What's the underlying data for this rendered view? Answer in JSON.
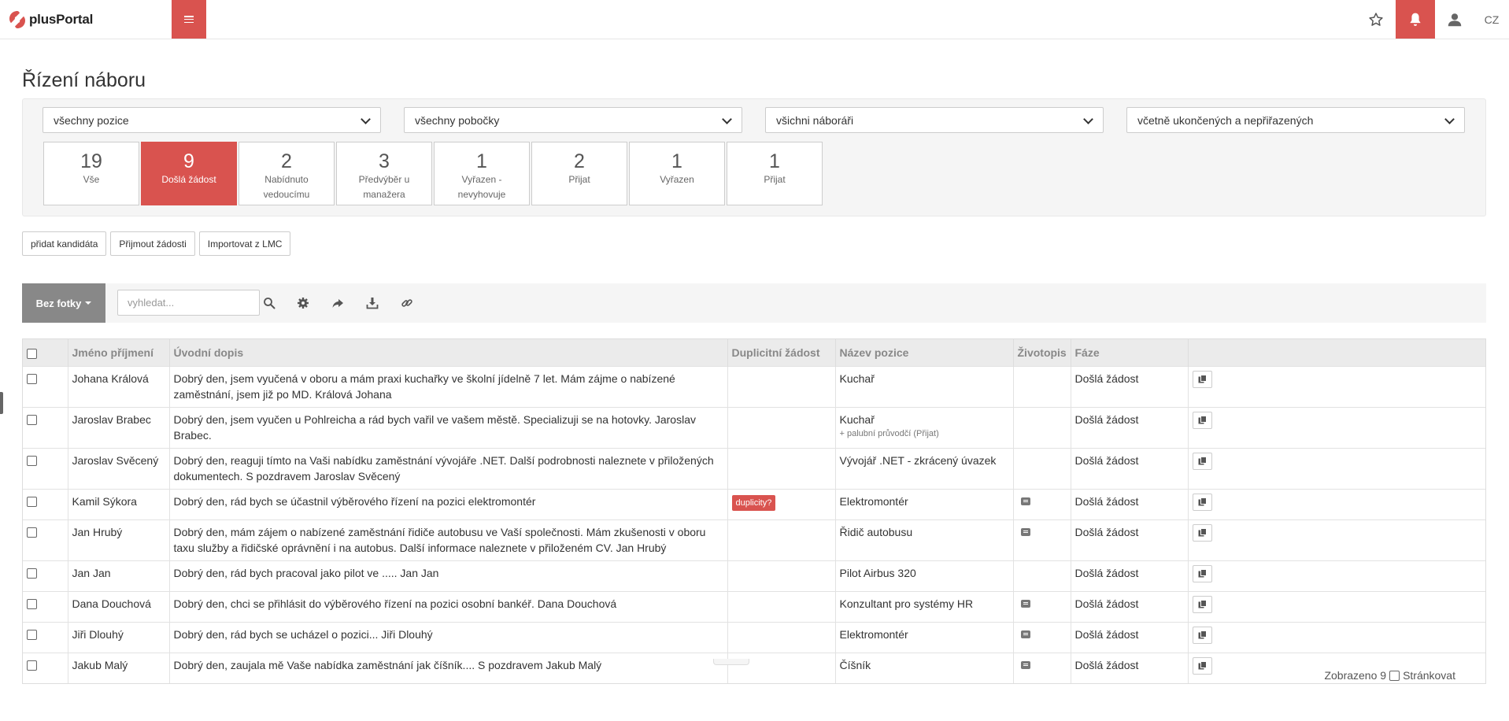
{
  "header": {
    "logo_text": "plusPortal",
    "lang": "CZ",
    "accent": "#d9534f"
  },
  "page": {
    "title": "Řízení náboru"
  },
  "filters": [
    "všechny pozice",
    "všechny pobočky",
    "všichni náboráři",
    "včetně ukončených a nepřiřazených"
  ],
  "stages": [
    {
      "count": "19",
      "label": "Vše"
    },
    {
      "count": "9",
      "label": "Došlá žádost"
    },
    {
      "count": "2",
      "label": "Nabídnuto vedoucímu"
    },
    {
      "count": "3",
      "label": "Předvýběr u manažera"
    },
    {
      "count": "1",
      "label": "Vyřazen - nevyhovuje"
    },
    {
      "count": "2",
      "label": "Přijat"
    },
    {
      "count": "1",
      "label": "Vyřazen"
    },
    {
      "count": "1",
      "label": "Přijat"
    }
  ],
  "actions": {
    "add_candidate": "přidat kandidáta",
    "accept_requests": "Přijmout žádosti",
    "import_lmc": "Importovat z LMC"
  },
  "toolbar": {
    "photo_toggle": "Bez fotky",
    "search_placeholder": "vyhledat..."
  },
  "table": {
    "columns": {
      "name": "Jméno příjmení",
      "letter": "Úvodní dopis",
      "duplicate": "Duplicitní žádost",
      "position": "Název pozice",
      "cv": "Životopis",
      "phase": "Fáze"
    },
    "rows": [
      {
        "name": "Johana Králová",
        "letter": "Dobrý den, jsem vyučená v oboru a mám praxi kuchařky ve školní jídelně 7 let. Mám zájme o nabízené zaměstnání, jsem již po MD. Králová Johana",
        "duplicate": "",
        "position": "Kuchař",
        "position_sub": "",
        "cv": false,
        "phase": "Došlá žádost"
      },
      {
        "name": "Jaroslav Brabec",
        "letter": "Dobrý den, jsem vyučen u Pohlreicha a rád bych vařil ve vašem městě. Specializuji se na hotovky. Jaroslav Brabec.",
        "duplicate": "",
        "position": "Kuchař",
        "position_sub": "+ palubní průvodčí (Přijat)",
        "cv": false,
        "phase": "Došlá žádost"
      },
      {
        "name": "Jaroslav Svěcený",
        "letter": "Dobrý den, reaguji tímto na Vaši nabídku zaměstnání vývojáře .NET. Další podrobnosti naleznete v přiložených dokumentech. S pozdravem Jaroslav Svěcený",
        "duplicate": "",
        "position": "Vývojář .NET - zkrácený úvazek",
        "position_sub": "",
        "cv": false,
        "phase": "Došlá žádost"
      },
      {
        "name": "Kamil Sýkora",
        "letter": "Dobrý den, rád bych se účastnil výběrového řízení na pozici elektromontér",
        "duplicate": "duplicity?",
        "position": "Elektromontér",
        "position_sub": "",
        "cv": true,
        "phase": "Došlá žádost"
      },
      {
        "name": "Jan Hrubý",
        "letter": "Dobrý den, mám zájem o nabízené zaměstnání řidiče autobusu ve Vaší společnosti. Mám zkušenosti v oboru taxu služby a řidičské oprávnění i na autobus. Další informace naleznete v přiloženém CV. Jan Hrubý",
        "duplicate": "",
        "position": "Řidič autobusu",
        "position_sub": "",
        "cv": true,
        "phase": "Došlá žádost"
      },
      {
        "name": "Jan Jan",
        "letter": "Dobrý den, rád bych pracoval jako pilot ve ..... Jan Jan",
        "duplicate": "",
        "position": "Pilot Airbus 320",
        "position_sub": "",
        "cv": false,
        "phase": "Došlá žádost"
      },
      {
        "name": "Dana Douchová",
        "letter": "Dobrý den, chci se přihlásit do výběrového řízení na pozici osobní bankéř. Dana Douchová",
        "duplicate": "",
        "position": "Konzultant pro systémy HR",
        "position_sub": "",
        "cv": true,
        "phase": "Došlá žádost"
      },
      {
        "name": "Jiři Dlouhý",
        "letter": "Dobrý den, rád bych se ucházel o pozici... Jiři Dlouhý",
        "duplicate": "",
        "position": "Elektromontér",
        "position_sub": "",
        "cv": true,
        "phase": "Došlá žádost"
      },
      {
        "name": "Jakub Malý",
        "letter": "Dobrý den, zaujala mě Vaše nabídka zaměstnání jak číšník.... S pozdravem Jakub Malý",
        "duplicate": "",
        "position": "Číšník",
        "position_sub": "",
        "cv": true,
        "phase": "Došlá žádost"
      }
    ]
  },
  "footer": {
    "shown": "Zobrazeno 9",
    "paginate": "Stránkovat"
  }
}
